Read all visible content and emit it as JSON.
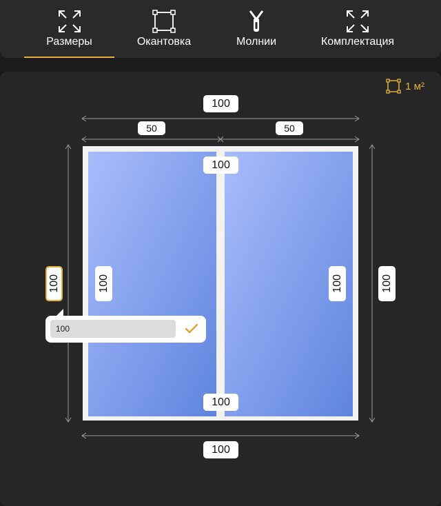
{
  "tabs": [
    {
      "label": "Размеры",
      "icon": "expand-icon",
      "active": true
    },
    {
      "label": "Окантовка",
      "icon": "frame-square-icon",
      "active": false
    },
    {
      "label": "Молнии",
      "icon": "zipper-icon",
      "active": false
    },
    {
      "label": "Комплектация",
      "icon": "expand-icon",
      "active": false
    }
  ],
  "area": {
    "value": "1 м²"
  },
  "dimensions": {
    "top_total": "100",
    "top_left_section": "50",
    "top_right_section": "50",
    "divider_top": "100",
    "divider_bottom": "100",
    "left_outer": "100",
    "left_inner": "100",
    "right_inner": "100",
    "right_outer": "100",
    "bottom_total": "100"
  },
  "editor": {
    "value": "100"
  },
  "colors": {
    "accent": "#e3b23c",
    "glass_light": "#a8bcfb",
    "glass_dark": "#5f84de"
  }
}
